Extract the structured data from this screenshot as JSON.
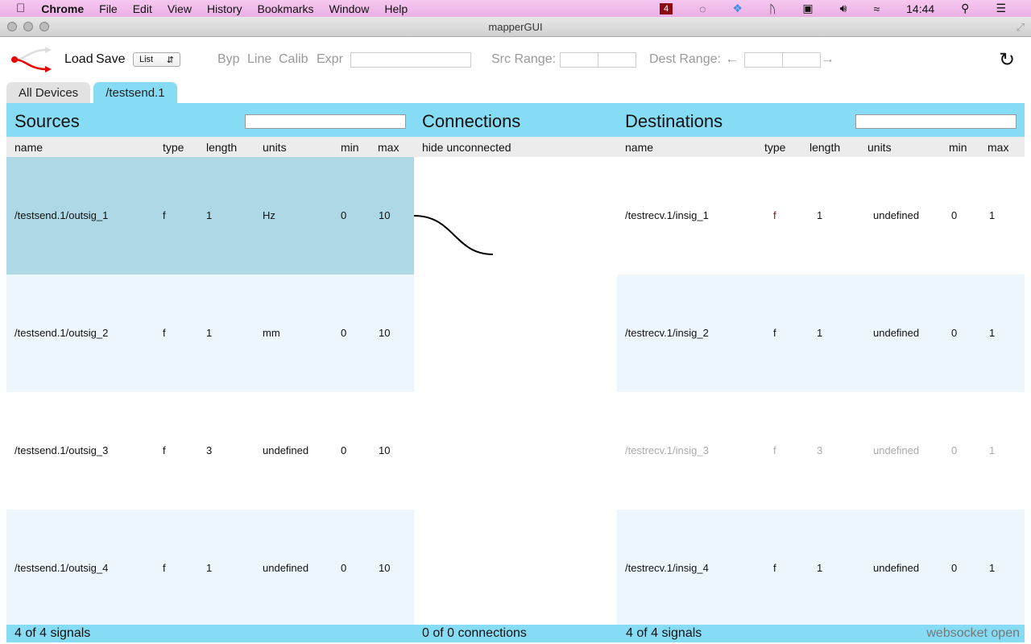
{
  "menubar": {
    "app": "Chrome",
    "items": [
      "File",
      "Edit",
      "View",
      "History",
      "Bookmarks",
      "Window",
      "Help"
    ],
    "badge": "4",
    "clock": "14:44"
  },
  "window": {
    "title": "mapperGUI"
  },
  "toolbar": {
    "load": "Load",
    "save": "Save",
    "view_select": "List",
    "byp": "Byp",
    "line": "Line",
    "calib": "Calib",
    "expr": "Expr",
    "expr_value": "",
    "src_range": "Src Range:",
    "dest_range": "Dest Range:"
  },
  "tabs": [
    {
      "label": "All Devices",
      "active": false
    },
    {
      "label": "/testsend.1",
      "active": true
    }
  ],
  "sources": {
    "title": "Sources",
    "search": "",
    "columns": [
      "name",
      "type",
      "length",
      "units",
      "min",
      "max"
    ],
    "rows": [
      [
        "/testsend.1/outsig_1",
        "f",
        "1",
        "Hz",
        "0",
        "10"
      ],
      [
        "/testsend.1/outsig_2",
        "f",
        "1",
        "mm",
        "0",
        "10"
      ],
      [
        "/testsend.1/outsig_3",
        "f",
        "3",
        "undefined",
        "0",
        "10"
      ],
      [
        "/testsend.1/outsig_4",
        "f",
        "1",
        "undefined",
        "0",
        "10"
      ]
    ],
    "footer": "4 of 4 signals"
  },
  "connections": {
    "title": "Connections",
    "hide_label": "hide unconnected",
    "footer": "0 of 0 connections"
  },
  "destinations": {
    "title": "Destinations",
    "search": "",
    "columns": [
      "name",
      "type",
      "length",
      "units",
      "min",
      "max"
    ],
    "rows": [
      [
        "/testrecv.1/insig_1",
        "f",
        "1",
        "undefined",
        "0",
        "1"
      ],
      [
        "/testrecv.1/insig_2",
        "f",
        "1",
        "undefined",
        "0",
        "1"
      ],
      [
        "/testrecv.1/insig_3",
        "f",
        "3",
        "undefined",
        "0",
        "1"
      ],
      [
        "/testrecv.1/insig_4",
        "f",
        "1",
        "undefined",
        "0",
        "1"
      ]
    ],
    "footer": "4 of 4 signals"
  },
  "status": "websocket open",
  "colors": {
    "accent": "#87dcf5",
    "selected_row": "#aed8e5",
    "alt_row": "#edf5fd"
  }
}
